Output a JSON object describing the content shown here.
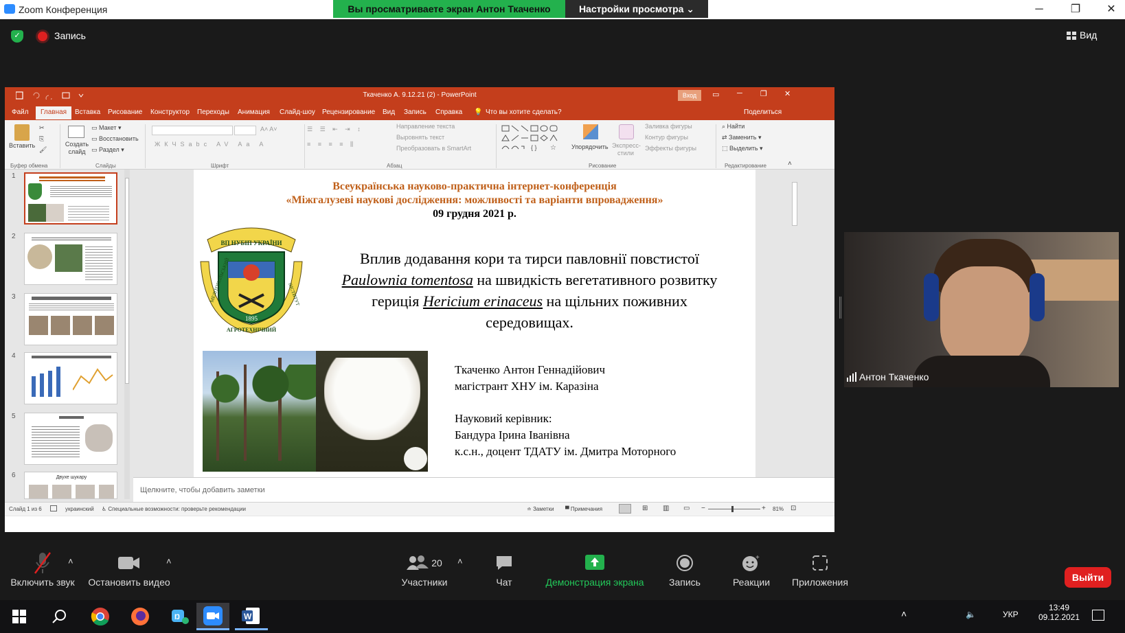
{
  "window": {
    "title": "Zoom Конференция",
    "share_banner": "Вы просматриваете экран Антон Ткаченко",
    "view_options": "Настройки просмотра ⌄",
    "minimize": "─",
    "maximize": "❐",
    "close": "✕"
  },
  "topbar": {
    "record_label": "Запись",
    "view_label": "Вид"
  },
  "ppt": {
    "title": "Ткаченко А. 9.12.21 (2)  -  PowerPoint",
    "signin": "Вход",
    "tabs": [
      "Файл",
      "Главная",
      "Вставка",
      "Рисование",
      "Конструктор",
      "Переходы",
      "Анимация",
      "Слайд-шоу",
      "Рецензирование",
      "Вид",
      "Запись",
      "Справка"
    ],
    "tell_me": "Что вы хотите сделать?",
    "share": "Поделиться",
    "ribbon": {
      "paste": "Вставить",
      "new_slide": "Создать слайд",
      "layout": "Макет",
      "reset": "Восстановить",
      "section": "Раздел",
      "text_direction": "Направление текста",
      "align_text": "Выровнять текст",
      "smartart": "Преобразовать в SmartArt",
      "arrange": "Упорядочить",
      "quick_styles": "Экспресс-стили",
      "shape_fill": "Заливка фигуры",
      "shape_outline": "Контур фигуры",
      "shape_effects": "Эффекты фигуры",
      "find": "Найти",
      "replace": "Заменить",
      "select": "Выделить",
      "groups": [
        "Буфер обмена",
        "Слайды",
        "Шрифт",
        "Абзац",
        "Рисование",
        "Редактирование"
      ]
    },
    "thumb_numbers": [
      "1",
      "2",
      "3",
      "4",
      "5",
      "6"
    ],
    "thumb6_title": "Двухе шукару",
    "slide": {
      "header1": "Всеукраїнська науково-практична інтернет-конференція",
      "header2": "«Міжгалузеві наукові дослідження: можливості та варіанти впровадження»",
      "date": "09 грудня 2021 р.",
      "title_l1": "Вплив додавання кори та тирси павловнії повстистої",
      "title_l2_italic": "Paulownia tomentosa",
      "title_l2_rest": " на швидкість вегетативного розвитку",
      "title_l3_a": "гериція ",
      "title_l3_italic": "Hericium erinaceus",
      "title_l3_b": " на щільних поживних",
      "title_l4": "середовищах.",
      "author": "Ткаченко Антон Геннадійович",
      "author_role": "магістрант ХНУ ім. Каразіна",
      "supervisor_label": "Науковий керівник:",
      "supervisor_name": "Бандура Ірина Іванівна",
      "supervisor_role": "к.с.н., доцент ТДАТУ ім. Дмитра Моторного",
      "logo_top": "ВП НУБІП УКРАЇНИ",
      "logo_left": "МЕЛІТОПОЛЬСЬКИЙ",
      "logo_bottom": "АГРОТЕХНІЧНИЙ",
      "logo_right": "ІНСТИТУТ",
      "logo_year": "1895"
    },
    "notes_placeholder": "Щелкните, чтобы добавить заметки",
    "status": {
      "slide_counter": "Слайд 1 из 6",
      "language": "украинский",
      "accessibility": "Специальные возможности: проверьте рекомендации",
      "notes": "Заметки",
      "comments": "Примечания",
      "zoom": "81%"
    }
  },
  "webcam": {
    "name": "Антон Ткаченко"
  },
  "toolbar": {
    "unmute": "Включить звук",
    "stop_video": "Остановить видео",
    "participants": "Участники",
    "participants_count": "20",
    "chat": "Чат",
    "share_screen": "Демонстрация экрана",
    "record": "Запись",
    "reactions": "Реакции",
    "apps": "Приложения",
    "leave": "Выйти"
  },
  "taskbar": {
    "lang": "УКР",
    "time": "13:49",
    "date": "09.12.2021"
  },
  "colors": {
    "ppt_accent": "#c43e1c",
    "zoom_green": "#23b14d",
    "zoom_blue": "#2d8cff",
    "slide_orange": "#c0601a"
  }
}
